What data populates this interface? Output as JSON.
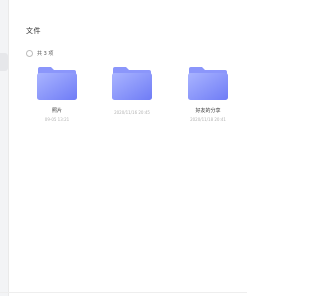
{
  "page": {
    "title": "文件",
    "count_label": "共 3 项"
  },
  "folders": [
    {
      "name": "照片",
      "time": "09-05 13:21"
    },
    {
      "name": "",
      "time": "2020/11/16 20:45"
    },
    {
      "name": "好友的分享",
      "time": "2020/11/18 20:41"
    }
  ],
  "colors": {
    "folder_light": "#a9b4ff",
    "folder_dark": "#6f7cf6",
    "folder_tab": "#8b96fb"
  },
  "icons": {
    "folder": "folder-icon"
  }
}
